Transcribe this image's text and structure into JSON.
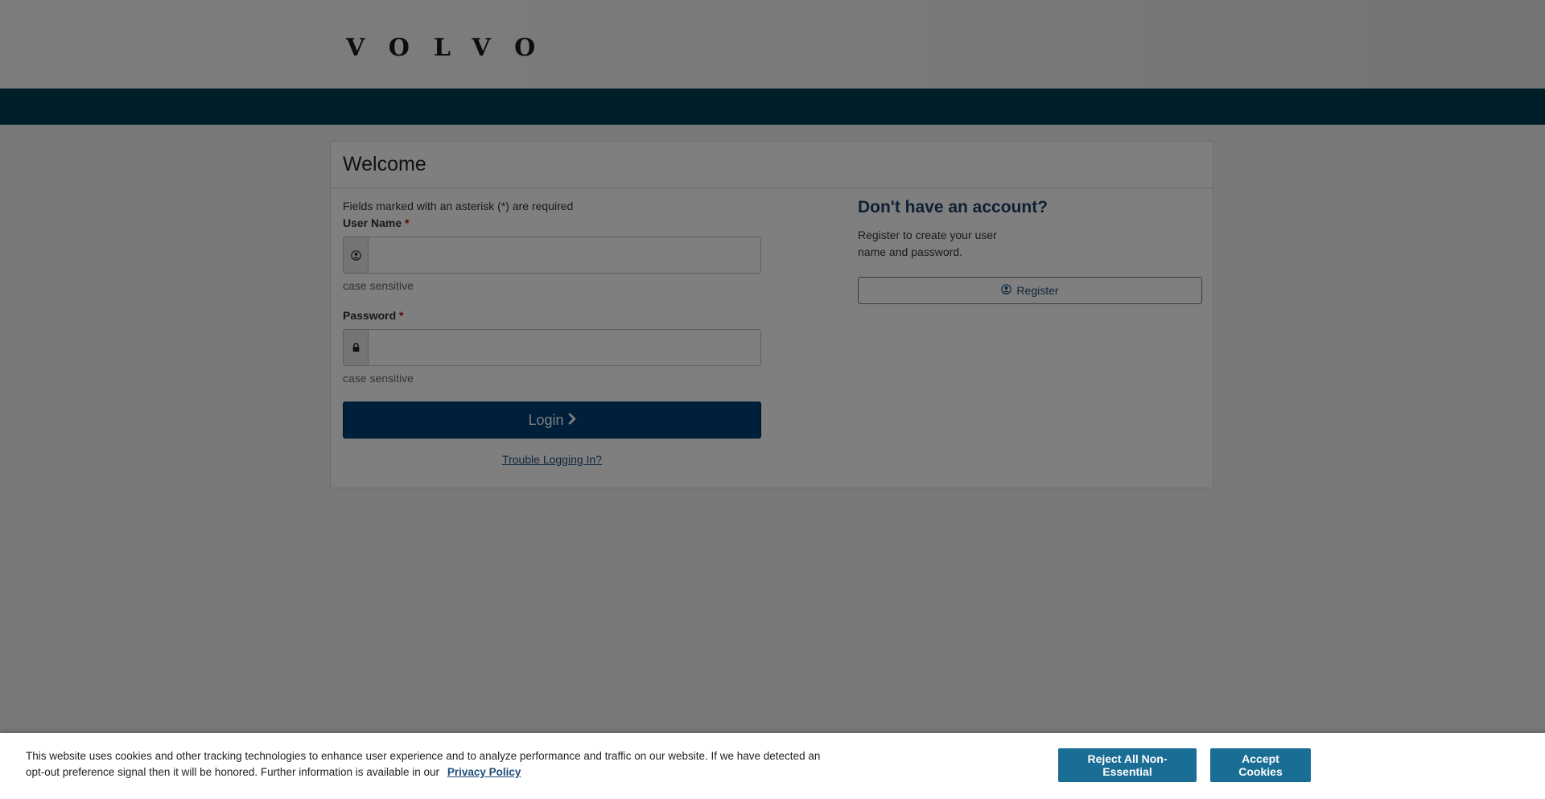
{
  "header": {
    "logo_text": "VOLVO"
  },
  "colors": {
    "navbar": "#003e51",
    "login_button": "#003e74",
    "cookie_button": "#1a6d94",
    "required_asterisk": "#cc0000"
  },
  "card": {
    "title": "Welcome",
    "required_note": "Fields marked with an asterisk (*) are required",
    "username": {
      "label": "User Name",
      "asterisk": "*",
      "icon": "user-circle-icon",
      "value": "",
      "help": "case sensitive"
    },
    "password": {
      "label": "Password",
      "asterisk": "*",
      "icon": "lock-icon",
      "value": "",
      "help": "case sensitive"
    },
    "login_button": {
      "label": "Login",
      "icon": "chevron-right-icon"
    },
    "trouble_link": "Trouble Logging In?"
  },
  "register": {
    "title": "Don't have an account?",
    "text": "Register to create your user name and password.",
    "button": {
      "label": "Register",
      "icon": "user-circle-icon"
    }
  },
  "cookie_banner": {
    "text": "This website uses cookies and other tracking technologies to enhance user experience and to analyze performance and traffic on our website. If we have detected an opt-out preference signal then it will be honored. Further information is available in our",
    "privacy_link": "Privacy Policy",
    "reject_button": "Reject All Non-Essential",
    "accept_button": "Accept Cookies"
  }
}
